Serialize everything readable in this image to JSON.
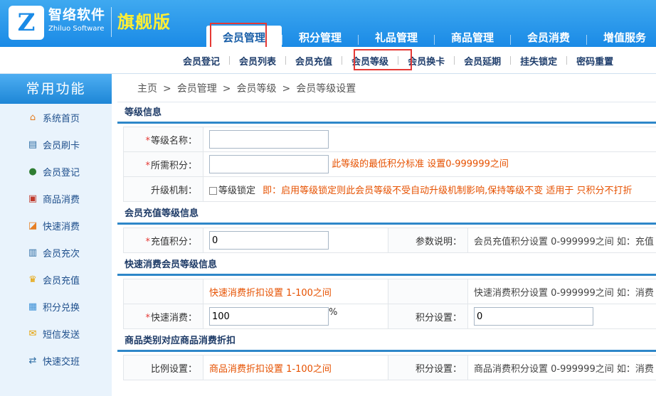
{
  "header": {
    "logo_letter": "Z",
    "logo_cn": "智络软件",
    "logo_en": "Zhiluo Software",
    "edition": "旗舰版"
  },
  "main_nav": [
    {
      "label": "会员管理",
      "active": true
    },
    {
      "label": "积分管理",
      "active": false
    },
    {
      "label": "礼品管理",
      "active": false
    },
    {
      "label": "商品管理",
      "active": false
    },
    {
      "label": "会员消费",
      "active": false
    },
    {
      "label": "增值服务",
      "active": false
    }
  ],
  "sub_nav": [
    {
      "label": "会员登记"
    },
    {
      "label": "会员列表"
    },
    {
      "label": "会员充值"
    },
    {
      "label": "会员等级"
    },
    {
      "label": "会员换卡"
    },
    {
      "label": "会员延期"
    },
    {
      "label": "挂失锁定"
    },
    {
      "label": "密码重置"
    }
  ],
  "sidebar": {
    "title": "常用功能",
    "items": [
      {
        "label": "系统首页",
        "icon": "home-icon"
      },
      {
        "label": "会员刷卡",
        "icon": "card-user-icon"
      },
      {
        "label": "会员登记",
        "icon": "users-icon"
      },
      {
        "label": "商品消费",
        "icon": "cart-icon"
      },
      {
        "label": "快速消费",
        "icon": "chart-icon"
      },
      {
        "label": "会员充次",
        "icon": "cart-plus-icon"
      },
      {
        "label": "会员充值",
        "icon": "crown-icon"
      },
      {
        "label": "积分兑换",
        "icon": "gift-icon"
      },
      {
        "label": "短信发送",
        "icon": "envelope-icon"
      },
      {
        "label": "快速交班",
        "icon": "user-switch-icon"
      }
    ]
  },
  "breadcrumb": [
    "主页",
    "会员管理",
    "会员等级",
    "会员等级设置"
  ],
  "breadcrumb_sep": ">",
  "sections": {
    "level_info": {
      "title": "等级信息",
      "name_label": "等级名称：",
      "name_value": "",
      "points_label": "所需积分：",
      "points_value": "",
      "points_hint": "此等级的最低积分标准 设置0-999999之间",
      "upgrade_label": "升级机制：",
      "lock_label": "等级锁定",
      "lock_checked": false,
      "lock_hint": "即：启用等级锁定则此会员等级不受自动升级机制影响,保持等级不变 适用于 只积分不打折"
    },
    "recharge": {
      "title": "会员充值等级信息",
      "points_label": "充值积分：",
      "points_value": "0",
      "param_label": "参数说明：",
      "param_note": "会员充值积分设置 0-999999之间 如：充值"
    },
    "quick": {
      "title": "快速消费会员等级信息",
      "discount_hint": "快速消费折扣设置 1-100之间",
      "points_note": "快速消费积分设置 0-999999之间 如：消费",
      "quick_label": "快速消费：",
      "quick_value": "100",
      "percent": "%",
      "points_label": "积分设置：",
      "points_value": "0"
    },
    "category": {
      "title": "商品类别对应商品消费折扣",
      "ratio_label": "比例设置：",
      "discount_hint": "商品消费折扣设置 1-100之间",
      "points_label": "积分设置：",
      "points_note": "商品消费积分设置 0-999999之间 如：消费"
    }
  },
  "colors": {
    "header_blue": "#1a8ae6",
    "highlight_red": "#e53935",
    "hint_orange": "#e65100",
    "section_rule": "#2e87c9"
  }
}
